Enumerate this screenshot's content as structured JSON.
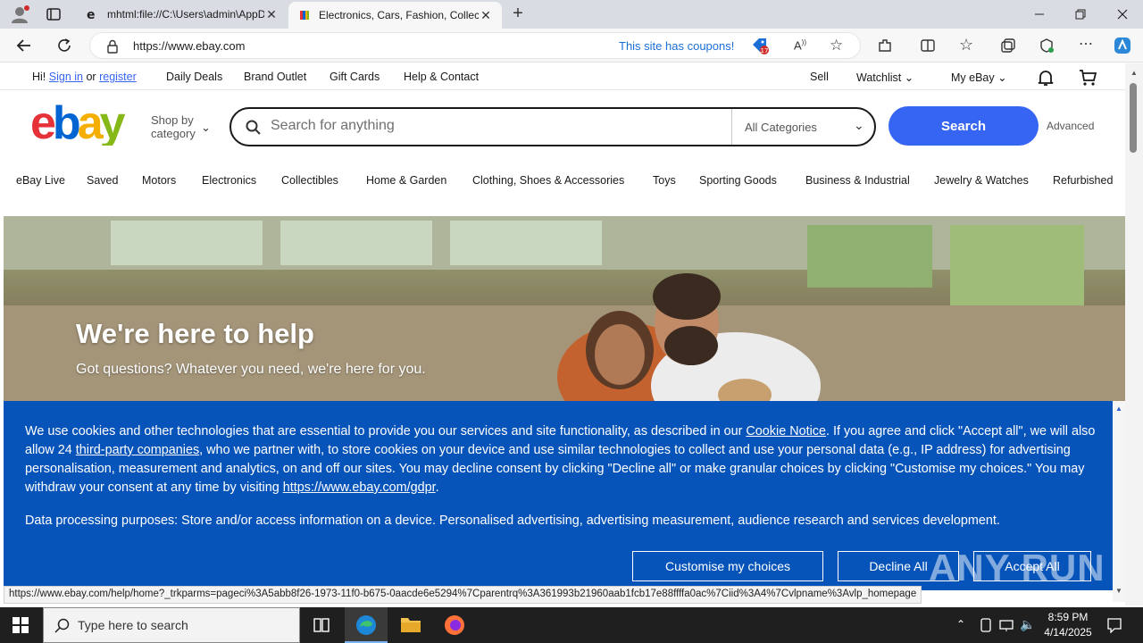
{
  "browser": {
    "tabs": [
      {
        "title": "mhtml:file://C:\\Users\\admin\\AppData"
      },
      {
        "title": "Electronics, Cars, Fashion, Collectibles & More | eBay"
      }
    ],
    "url": "https://www.ebay.com",
    "coupon_text": "This site has coupons!",
    "coupon_badge": "17"
  },
  "ebay": {
    "topnav": {
      "greeting": "Hi!",
      "sign_in": "Sign in",
      "or": "or",
      "register": "register",
      "daily_deals": "Daily Deals",
      "brand_outlet": "Brand Outlet",
      "gift_cards": "Gift Cards",
      "help_contact": "Help & Contact",
      "sell": "Sell",
      "watchlist": "Watchlist",
      "my_ebay": "My eBay"
    },
    "shop_by_category_line1": "Shop by",
    "shop_by_category_line2": "category",
    "search_placeholder": "Search for anything",
    "category_select": "All Categories",
    "search_button": "Search",
    "advanced": "Advanced",
    "categories": [
      "eBay Live",
      "Saved",
      "Motors",
      "Electronics",
      "Collectibles",
      "Home & Garden",
      "Clothing, Shoes & Accessories",
      "Toys",
      "Sporting Goods",
      "Business & Industrial",
      "Jewelry & Watches",
      "Refurbished"
    ],
    "hero": {
      "title": "We're here to help",
      "subtitle": "Got questions? Whatever you need, we're here for you."
    }
  },
  "cookie_banner": {
    "p1_a": "We use cookies and other technologies that are essential to provide you our services and site functionality, as described in our ",
    "cookie_notice": "Cookie Notice",
    "p1_b": ". If you agree and click \"Accept all\", we will also allow 24 ",
    "third_party": "third-party companies",
    "p1_c": ", who we partner with, to store cookies on your device and use similar technologies to collect and use your personal data (e.g., IP address) for advertising personalisation, measurement and analytics, on and off our sites. You may decline consent by clicking \"Decline all\" or make granular choices by clicking \"Customise my choices.\" You may withdraw your consent at any time by visiting ",
    "gdpr_link": "https://www.ebay.com/gdpr",
    "p1_d": ".",
    "p2": "Data processing purposes: Store and/or access information on a device. Personalised advertising, advertising measurement, audience research and services development.",
    "customise": "Customise my choices",
    "decline": "Decline All",
    "accept": "Accept All"
  },
  "status_url": "https://www.ebay.com/help/home?_trkparms=pageci%3A5abb8f26-1973-11f0-b675-0aacde6e5294%7Cparentrq%3A361993b21960aab1fcb17e88ffffa0ac%7Ciid%3A4%7Cvlpname%3Avlp_homepage",
  "taskbar": {
    "search_placeholder": "Type here to search",
    "time": "8:59 PM",
    "date": "4/14/2025"
  },
  "watermark": "ANY RUN",
  "colors": {
    "ebay_blue": "#3665f3",
    "cookie_blue": "#0654ba"
  }
}
